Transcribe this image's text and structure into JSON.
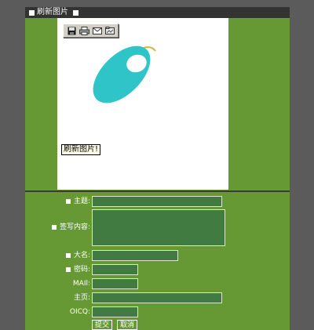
{
  "window": {
    "title": "刷新图片"
  },
  "toolbar": {
    "icons": [
      "save-icon",
      "print-icon",
      "mail-icon",
      "folder-icon"
    ]
  },
  "image": {
    "caption": "刷新图片!"
  },
  "form": {
    "subject_label": "主题:",
    "content_label": "签写内容:",
    "name_label": "大名:",
    "password_label": "密码:",
    "mail_label": "MAIl:",
    "homepage_label": "主页:",
    "oicq_label": "OICQ:",
    "submit_label": "提交",
    "cancel_label": "取消"
  },
  "colors": {
    "panel": "#669933",
    "field": "#427b42",
    "ellipse": "#2ec4c8"
  }
}
